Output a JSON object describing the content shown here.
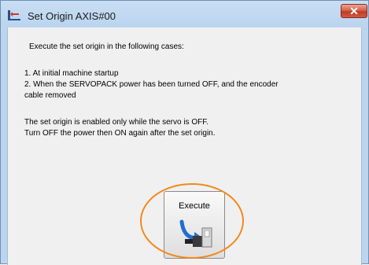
{
  "window": {
    "title": "Set Origin AXIS#00",
    "close_symbol": "✕",
    "icon": "set-origin-icon"
  },
  "content": {
    "intro": "Execute the set origin in the following cases:",
    "case1": " 1. At initial machine startup",
    "case2_line1": " 2. When the SERVOPACK power has been turned OFF, and the encoder",
    "case2_line2": "cable removed",
    "note1": "The set origin is enabled only while the servo is OFF.",
    "note2": "Turn OFF the power then ON again after the set origin."
  },
  "execute_button": {
    "label": "Execute",
    "icon": "motor-origin-icon"
  },
  "colors": {
    "title_bar": "#bcd5ef",
    "close_button": "#c23a25",
    "highlight_ring": "#f2891c"
  }
}
